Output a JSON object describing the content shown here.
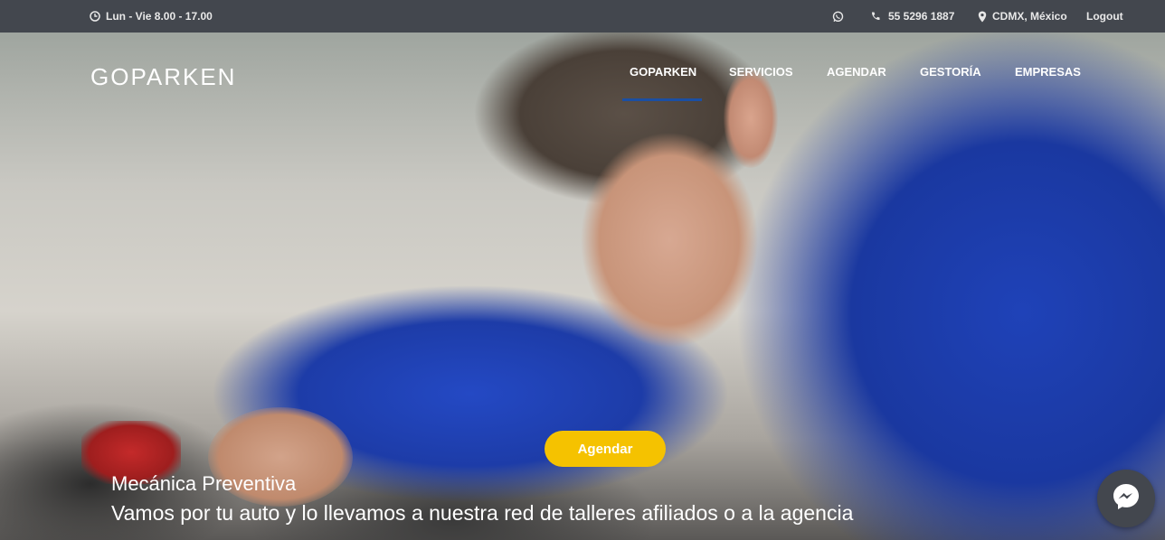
{
  "topbar": {
    "hours": "Lun - Vie 8.00 - 17.00",
    "phone": "55 5296 1887",
    "location": "CDMX, México",
    "logout": "Logout"
  },
  "header": {
    "logo": "GOPARKEN",
    "nav": [
      "GOPARKEN",
      "SERVICIOS",
      "AGENDAR",
      "GESTORÍA",
      "EMPRESAS"
    ],
    "active_nav": "GOPARKEN"
  },
  "hero": {
    "cta_label": "Agendar",
    "title": "Mecánica Preventiva",
    "subtitle": "Vamos por tu auto y lo llevamos a nuestra red de talleres afiliados o a la agencia"
  },
  "icons": {
    "clock": "clock-icon",
    "whatsapp": "whatsapp-icon",
    "phone": "phone-icon",
    "location": "map-pin-icon",
    "messenger": "messenger-icon"
  },
  "colors": {
    "topbar_bg": "#43474e",
    "cta_bg": "#f5c200",
    "nav_active_underline": "#1b4fa3",
    "messenger_bg": "#43474e"
  }
}
